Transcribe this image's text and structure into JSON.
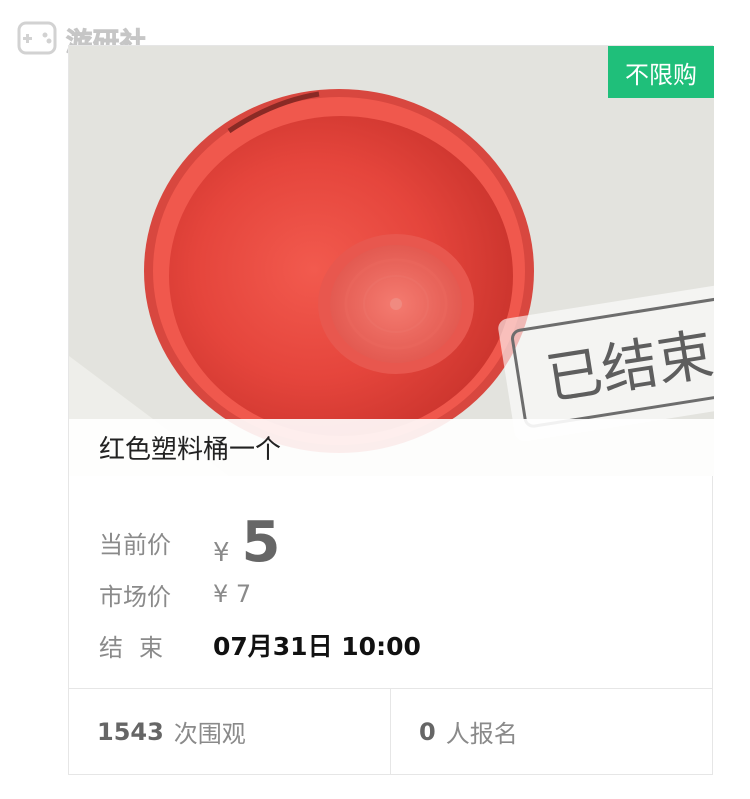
{
  "watermark": {
    "text": "游研社"
  },
  "item": {
    "badge": "不限购",
    "stamp": "已结束",
    "title": "红色塑料桶一个"
  },
  "details": {
    "current_price_label": "当前价",
    "currency": "¥",
    "current_price": "5",
    "market_price_label": "市场价",
    "market_price": "¥ 7",
    "end_label": "结束",
    "end_time": "07月31日 10:00"
  },
  "stats": {
    "views_count": "1543",
    "views_label": "次围观",
    "signups_count": "0",
    "signups_label": "人报名"
  },
  "colors": {
    "badge": "#1fbf7a",
    "bucket": "#e8453f"
  }
}
